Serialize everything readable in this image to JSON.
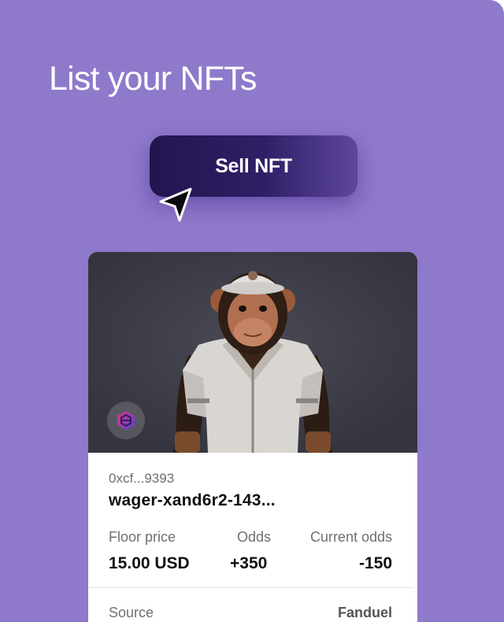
{
  "header": {
    "title": "List your NFTs"
  },
  "action": {
    "sell_label": "Sell NFT"
  },
  "card": {
    "owner_address": "0xcf...9393",
    "nft_name": "wager-xand6r2-143...",
    "stats": {
      "floor_price_label": "Floor price",
      "floor_price_value": "15.00 USD",
      "odds_label": "Odds",
      "odds_value": "+350",
      "current_odds_label": "Current odds",
      "current_odds_value": "-150"
    },
    "source_label": "Source",
    "source_value": "Fanduel",
    "image_icon": "ape-nft-artwork",
    "chain_icon": "chain-logo-icon"
  },
  "colors": {
    "background": "#8f79cb",
    "button_dark": "#22154f",
    "button_light": "#5e479e",
    "art_background": "#3a3a45"
  }
}
